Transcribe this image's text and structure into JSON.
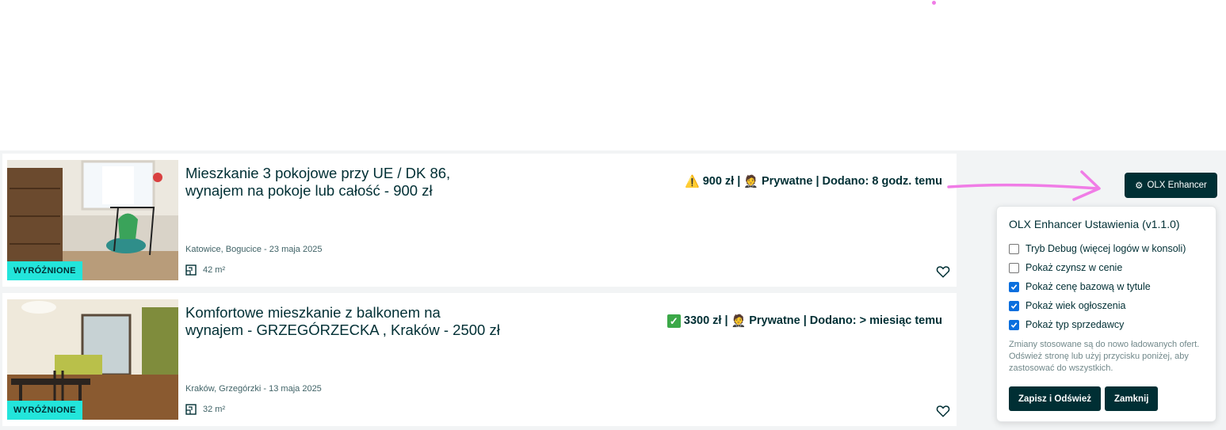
{
  "listings": [
    {
      "title_line1": "Mieszkanie 3 pokojowe przy UE / DK 86,",
      "title_line2": "wynajem na pokoje lub całość - 900 zł",
      "badge": "WYRÓŻNIONE",
      "price_icon": "⚠️",
      "price_text": "900 zł |",
      "seller_icon": "🤵",
      "info_text": "Prywatne | Dodano: 8 godz. temu",
      "location": "Katowice, Bogucice - 23 maja 2025",
      "area": "42 m²"
    },
    {
      "title_line1": "Komfortowe mieszkanie z balkonem na",
      "title_line2": "wynajem - GRZEGÓRZECKA , Kraków - 2500 zł",
      "badge": "WYRÓŻNIONE",
      "price_icon": "✓",
      "price_text": "3300 zł |",
      "seller_icon": "🤵",
      "info_text": "Prywatne | Dodano: > miesiąc temu",
      "location": "Kraków, Grzegórzki - 13 maja 2025",
      "area": "32 m²"
    }
  ],
  "enhancer_button": {
    "label": "OLX Enhancer",
    "icon": "gear-icon"
  },
  "settings": {
    "title": "OLX Enhancer Ustawienia (v1.1.0)",
    "options": [
      {
        "label": "Tryb Debug (więcej logów w konsoli)",
        "checked": false
      },
      {
        "label": "Pokaż czynsz w cenie",
        "checked": false
      },
      {
        "label": "Pokaż cenę bazową w tytule",
        "checked": true
      },
      {
        "label": "Pokaż wiek ogłoszenia",
        "checked": true
      },
      {
        "label": "Pokaż typ sprzedawcy",
        "checked": true
      }
    ],
    "note": "Zmiany stosowane są do nowo ładowanych ofert. Odśwież stronę lub użyj przycisku poniżej, aby zastosować do wszystkich.",
    "save_label": "Zapisz i Odśwież",
    "close_label": "Zamknij"
  },
  "colors": {
    "brand_dark": "#002f34",
    "badge": "#23e5db",
    "annotation_pink": "#f07ce6",
    "checkbox_blue": "#0b6fde"
  }
}
